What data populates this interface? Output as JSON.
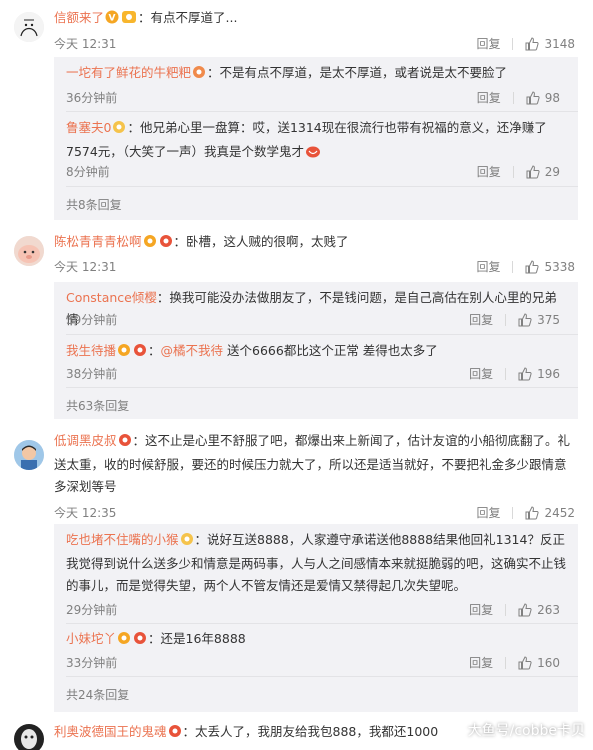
{
  "c1": {
    "user": "信额来了",
    "text": "：有点不厚道了...",
    "time": "今天 12:31",
    "reply": "回复",
    "likes": "3148",
    "subs": [
      {
        "user": "一坨有了鲜花的牛粑粑",
        "text": "：不是有点不厚道，是太不厚道，或者说是太不要脸了",
        "time": "36分钟前",
        "reply": "回复",
        "likes": "98"
      },
      {
        "user": "鲁塞夫0",
        "text": "：他兄弟心里一盘算：哎，送1314现在很流行也带有祝福的意义，还净赚了7574元，（大笑了一声）我真是个数学鬼才",
        "time": "8分钟前",
        "reply": "回复",
        "likes": "29"
      }
    ],
    "more": "共8条回复"
  },
  "c2": {
    "user": "陈松青青青松啊",
    "text": "：卧槽，这人贼的很啊，太贱了",
    "time": "今天 12:31",
    "reply": "回复",
    "likes": "5338",
    "subs": [
      {
        "user": "Constance倾樱",
        "text": "：换我可能没办法做朋友了，不是钱问题，是自己高估在别人心里的兄弟情",
        "time": "39分钟前",
        "reply": "回复",
        "likes": "375"
      },
      {
        "user": "我生待播",
        "mention": "@橘不我待",
        "text": " 送个6666都比这个正常 差得也太多了",
        "time": "38分钟前",
        "reply": "回复",
        "likes": "196"
      }
    ],
    "more": "共63条回复"
  },
  "c3": {
    "user": "低调黑皮叔",
    "text": "：这不止是心里不舒服了吧，都爆出来上新闻了，估计友谊的小船彻底翻了。礼送太重，收的时候舒服，要还的时候压力就大了，所以还是适当就好，不要把礼金多少跟情意多深划等号",
    "time": "今天 12:35",
    "reply": "回复",
    "likes": "2452",
    "subs": [
      {
        "user": "吃也堵不住嘴的小猴",
        "text": "：说好互送8888，人家遵守承诺送他8888结果他回礼1314？反正我觉得到说什么送多少和情意是两码事，人与人之间感情本来就挺脆弱的吧，这确实不止钱的事儿，而是觉得失望，两个人不管友情还是爱情又禁得起几次失望呢。",
        "time": "29分钟前",
        "reply": "回复",
        "likes": "263"
      },
      {
        "user": "小妹坨丫",
        "text": "：还是16年8888",
        "time": "33分钟前",
        "reply": "回复",
        "likes": "160"
      }
    ],
    "more": "共24条回复"
  },
  "c4": {
    "user": "利奥波德国王的鬼魂",
    "text": "：太丢人了，我朋友给我包888，我都还1000"
  },
  "watermark": "大鱼号/cobbe卡贝",
  "colors": {
    "username": "#eb7350",
    "meta": "#808080",
    "sub_bg": "#f2f2f5"
  }
}
